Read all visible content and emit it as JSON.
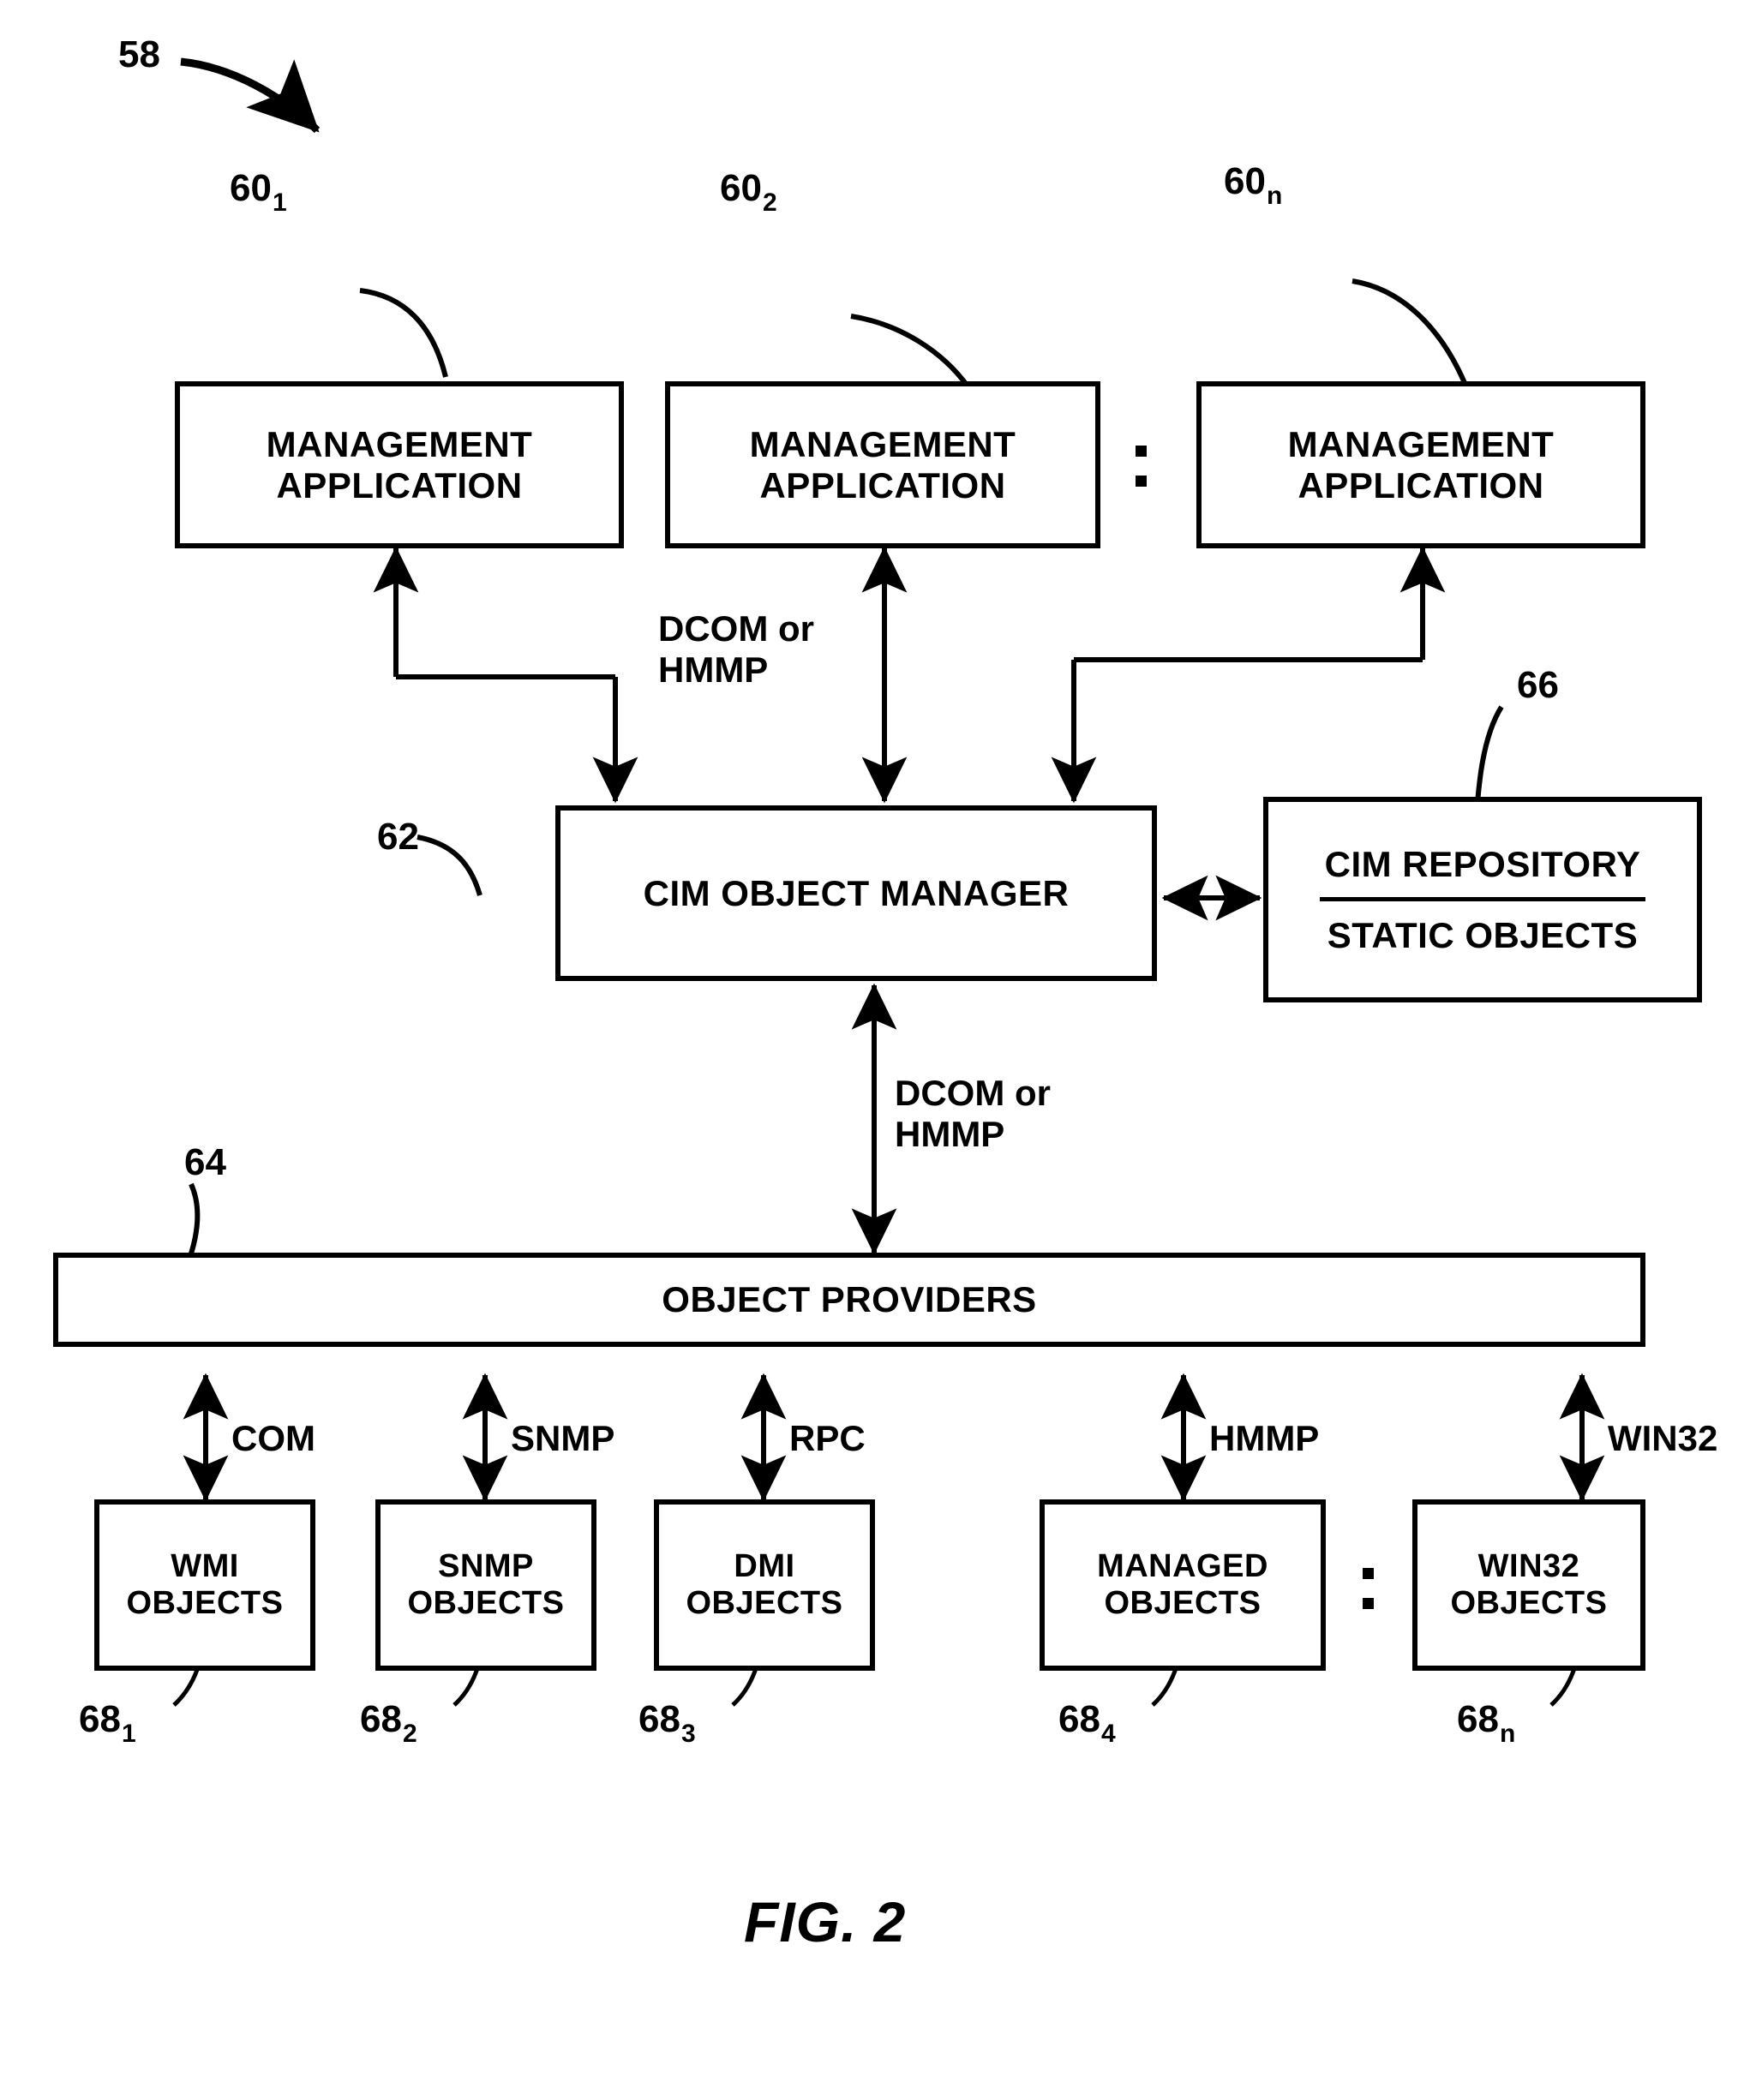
{
  "figure": {
    "caption": "FIG. 2",
    "system_ref": "58"
  },
  "management_applications": [
    {
      "ref_base": "60",
      "ref_sub": "1",
      "line1": "MANAGEMENT",
      "line2": "APPLICATION"
    },
    {
      "ref_base": "60",
      "ref_sub": "2",
      "line1": "MANAGEMENT",
      "line2": "APPLICATION"
    },
    {
      "ref_base": "60",
      "ref_sub": "n",
      "line1": "MANAGEMENT",
      "line2": "APPLICATION"
    }
  ],
  "object_manager": {
    "ref": "62",
    "label": "CIM OBJECT MANAGER"
  },
  "repository": {
    "ref": "66",
    "title": "CIM REPOSITORY",
    "subtitle": "STATIC OBJECTS"
  },
  "object_providers": {
    "ref": "64",
    "label": "OBJECT PROVIDERS"
  },
  "protocol_labels": {
    "upper_link_line1": "DCOM or",
    "upper_link_line2": "HMMP",
    "lower_link_line1": "DCOM or",
    "lower_link_line2": "HMMP"
  },
  "object_stores": [
    {
      "ref_base": "68",
      "ref_sub": "1",
      "line1": "WMI",
      "line2": "OBJECTS",
      "protocol": "COM"
    },
    {
      "ref_base": "68",
      "ref_sub": "2",
      "line1": "SNMP",
      "line2": "OBJECTS",
      "protocol": "SNMP"
    },
    {
      "ref_base": "68",
      "ref_sub": "3",
      "line1": "DMI",
      "line2": "OBJECTS",
      "protocol": "RPC"
    },
    {
      "ref_base": "68",
      "ref_sub": "4",
      "line1": "MANAGED",
      "line2": "OBJECTS",
      "protocol": "HMMP"
    },
    {
      "ref_base": "68",
      "ref_sub": "n",
      "line1": "WIN32",
      "line2": "OBJECTS",
      "protocol": "WIN32"
    }
  ],
  "colors": {
    "ink": "#000000",
    "paper": "#ffffff"
  }
}
